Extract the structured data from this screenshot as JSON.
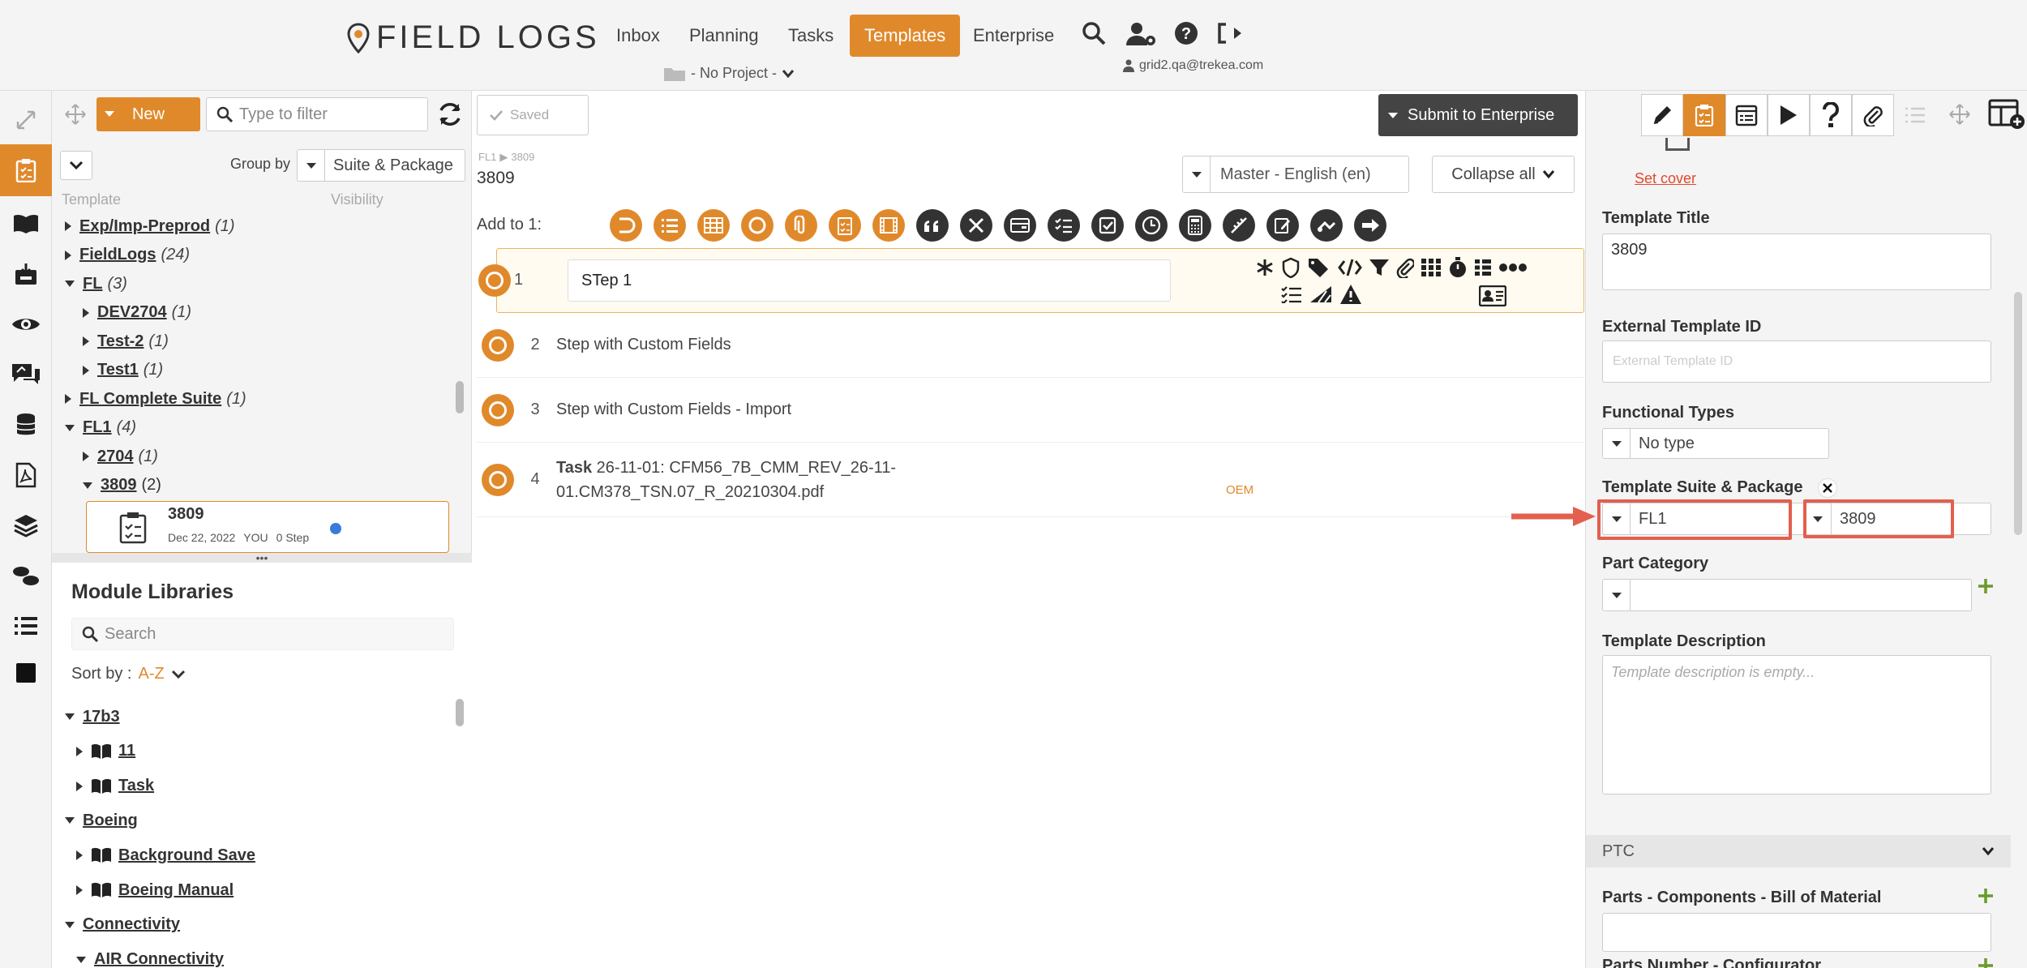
{
  "header": {
    "brand": "FIELD LOGS",
    "nav": [
      "Inbox",
      "Planning",
      "Tasks",
      "Templates",
      "Enterprise"
    ],
    "active_nav": "Templates",
    "project": "- No Project -",
    "user_email": "grid2.qa@trekea.com"
  },
  "toolbar": {
    "new_label": "New",
    "filter_placeholder": "Type to filter",
    "saved_label": "Saved",
    "submit_label": "Submit to Enterprise",
    "close_symbol": "×"
  },
  "left": {
    "group_by_label": "Group by",
    "group_by_value": "Suite & Package",
    "col_template": "Template",
    "col_visibility": "Visibility",
    "tree": [
      {
        "label": "Exp/Imp-Preprod",
        "count": "(1)",
        "level": 0,
        "open": false
      },
      {
        "label": "FieldLogs",
        "count": "(24)",
        "level": 0,
        "open": false
      },
      {
        "label": "FL",
        "count": "(3)",
        "level": 0,
        "open": true
      },
      {
        "label": "DEV2704",
        "count": "(1)",
        "level": 1,
        "open": false
      },
      {
        "label": "Test-2",
        "count": "(1)",
        "level": 1,
        "open": false
      },
      {
        "label": "Test1",
        "count": "(1)",
        "level": 1,
        "open": false
      },
      {
        "label": "FL Complete Suite",
        "count": "(1)",
        "level": 0,
        "open": false
      },
      {
        "label": "FL1",
        "count": "(4)",
        "level": 0,
        "open": true
      },
      {
        "label": "2704",
        "count": "(1)",
        "level": 1,
        "open": false
      },
      {
        "label": "3809",
        "count": "(2)",
        "level": 1,
        "open": true
      }
    ],
    "card": {
      "title": "3809",
      "date": "Dec 22, 2022",
      "owner": "YOU",
      "steps": "0 Step"
    },
    "divider_dots": "•••",
    "module": {
      "title": "Module Libraries",
      "search_placeholder": "Search",
      "sort_label": "Sort by :",
      "sort_value": "A-Z",
      "items": [
        {
          "label": "17b3",
          "level": 0,
          "open": true,
          "book": false
        },
        {
          "label": "11",
          "level": 1,
          "open": false,
          "book": true
        },
        {
          "label": "Task",
          "level": 1,
          "open": false,
          "book": true
        },
        {
          "label": "Boeing",
          "level": 0,
          "open": true,
          "book": false
        },
        {
          "label": "Background Save",
          "level": 1,
          "open": false,
          "book": true
        },
        {
          "label": "Boeing Manual",
          "level": 1,
          "open": false,
          "book": true
        },
        {
          "label": "Connectivity",
          "level": 0,
          "open": true,
          "book": false
        },
        {
          "label": "AIR Connectivity",
          "level": 1,
          "open": true,
          "book": false
        }
      ]
    }
  },
  "main": {
    "breadcrumb_1": "FL1",
    "breadcrumb_sep": "▶",
    "breadcrumb_2": "3809",
    "title": "3809",
    "language": "Master - English (en)",
    "collapse_label": "Collapse all",
    "add_to_label": "Add to 1:",
    "steps": [
      {
        "num": "1",
        "title": "STep 1"
      },
      {
        "num": "2",
        "title": "Step with Custom Fields"
      },
      {
        "num": "3",
        "title": "Step with Custom Fields - Import"
      },
      {
        "num": "4",
        "bold": "Task",
        "title": "26-11-01: CFM56_7B_CMM_REV_26-11-",
        "title2": "01.CM378_TSN.07_R_20210304.pdf",
        "badge": "OEM"
      }
    ]
  },
  "right": {
    "set_cover": "Set cover",
    "title_label": "Template Title",
    "title_value": "3809",
    "ext_id_label": "External Template ID",
    "ext_id_placeholder": "External Template ID",
    "func_types_label": "Functional Types",
    "func_types_value": "No type",
    "suite_label": "Template Suite & Package",
    "suite_value": "FL1",
    "package_value": "3809",
    "part_category_label": "Part Category",
    "desc_label": "Template Description",
    "desc_placeholder": "Template description is empty...",
    "ptc_label": "PTC",
    "parts_label": "Parts - Components - Bill of Material",
    "parts_number_label": "Parts Number - Configurator"
  },
  "colors": {
    "accent": "#e0892b",
    "dark": "#333333",
    "annotation": "#e35f4e",
    "green": "#6a9a2a"
  }
}
